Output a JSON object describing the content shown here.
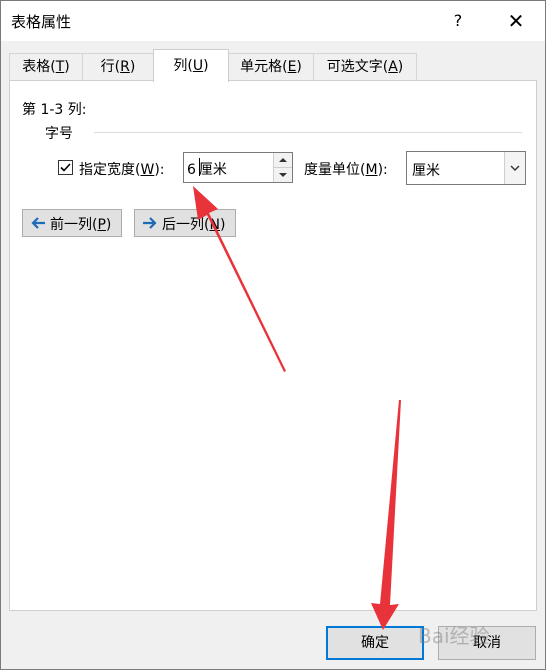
{
  "dialog": {
    "title": "表格属性",
    "help": "?",
    "close": "✕"
  },
  "tabs": [
    {
      "label": "表格(",
      "key": "T",
      "tail": ")"
    },
    {
      "label": "行(",
      "key": "R",
      "tail": ")"
    },
    {
      "label": "列(",
      "key": "U",
      "tail": ")"
    },
    {
      "label": "单元格(",
      "key": "E",
      "tail": ")"
    },
    {
      "label": "可选文字(",
      "key": "A",
      "tail": ")"
    }
  ],
  "active_tab": "列(U)",
  "column": {
    "heading": "第 1-3 列:",
    "group_label": "字号",
    "checkbox_label": "指定宽度(",
    "checkbox_key": "W",
    "checkbox_tail": "):",
    "checkbox_checked": true,
    "width_value": "6",
    "width_unit": "厘米",
    "measure_label": "度量单位(",
    "measure_key": "M",
    "measure_tail": "):",
    "measure_value": "厘米"
  },
  "nav": {
    "prev_label": "前一列(",
    "prev_key": "P",
    "prev_tail": ")",
    "next_label": "后一列(",
    "next_key": "N",
    "next_tail": ")"
  },
  "footer": {
    "ok_label": "确定",
    "cancel_label": "取消"
  },
  "watermark": "Bai经验",
  "colors": {
    "accent": "#0078d7",
    "annotation_arrow": "#e8333a"
  }
}
